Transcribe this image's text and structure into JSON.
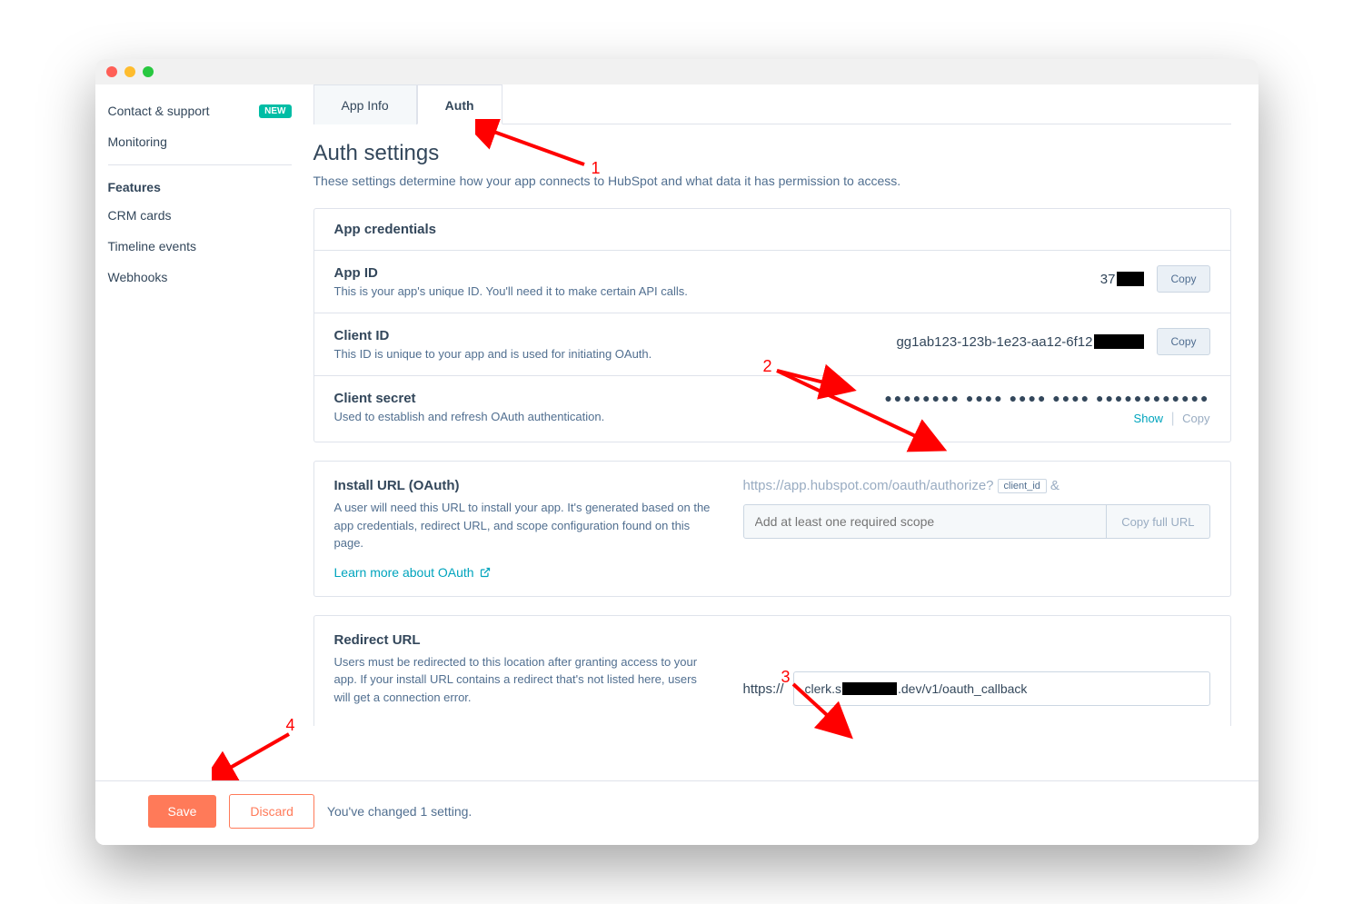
{
  "sidebar": {
    "items": [
      {
        "label": "Contact & support",
        "badge": "NEW"
      },
      {
        "label": "Monitoring"
      }
    ],
    "features_heading": "Features",
    "features": [
      {
        "label": "CRM cards"
      },
      {
        "label": "Timeline events"
      },
      {
        "label": "Webhooks"
      }
    ]
  },
  "tabs": {
    "app_info": "App Info",
    "auth": "Auth"
  },
  "page": {
    "title": "Auth settings",
    "description": "These settings determine how your app connects to HubSpot and what data it has permission to access."
  },
  "credentials": {
    "header": "App credentials",
    "app_id": {
      "title": "App ID",
      "desc": "This is your app's unique ID. You'll need it to make certain API calls.",
      "value_prefix": "37",
      "copy": "Copy"
    },
    "client_id": {
      "title": "Client ID",
      "desc": "This ID is unique to your app and is used for initiating OAuth.",
      "value_prefix": "gg1ab123-123b-1e23-aa12-6f12",
      "copy": "Copy"
    },
    "client_secret": {
      "title": "Client secret",
      "desc": "Used to establish and refresh OAuth authentication.",
      "dots": "●●●●●●●● ●●●● ●●●● ●●●● ●●●●●●●●●●●●",
      "show": "Show",
      "copy": "Copy"
    }
  },
  "install": {
    "title": "Install URL (OAuth)",
    "desc": "A user will need this URL to install your app. It's generated based on the app credentials, redirect URL, and scope configuration found on this page.",
    "learn_more": "Learn more about OAuth",
    "url_prefix": "https://app.hubspot.com/oauth/authorize?",
    "chip": "client_id",
    "amp": "&",
    "scope_placeholder": "Add at least one required scope",
    "copy_full": "Copy full URL"
  },
  "redirect": {
    "title": "Redirect URL",
    "desc": "Users must be redirected to this location after granting access to your app. If your install URL contains a redirect that's not listed here, users will get a connection error.",
    "proto": "https://",
    "value_prefix": "clerk.s",
    "value_suffix": ".dev/v1/oauth_callback"
  },
  "footer": {
    "save": "Save",
    "discard": "Discard",
    "message": "You've changed 1 setting."
  },
  "annotations": {
    "n1": "1",
    "n2": "2",
    "n3": "3",
    "n4": "4"
  }
}
